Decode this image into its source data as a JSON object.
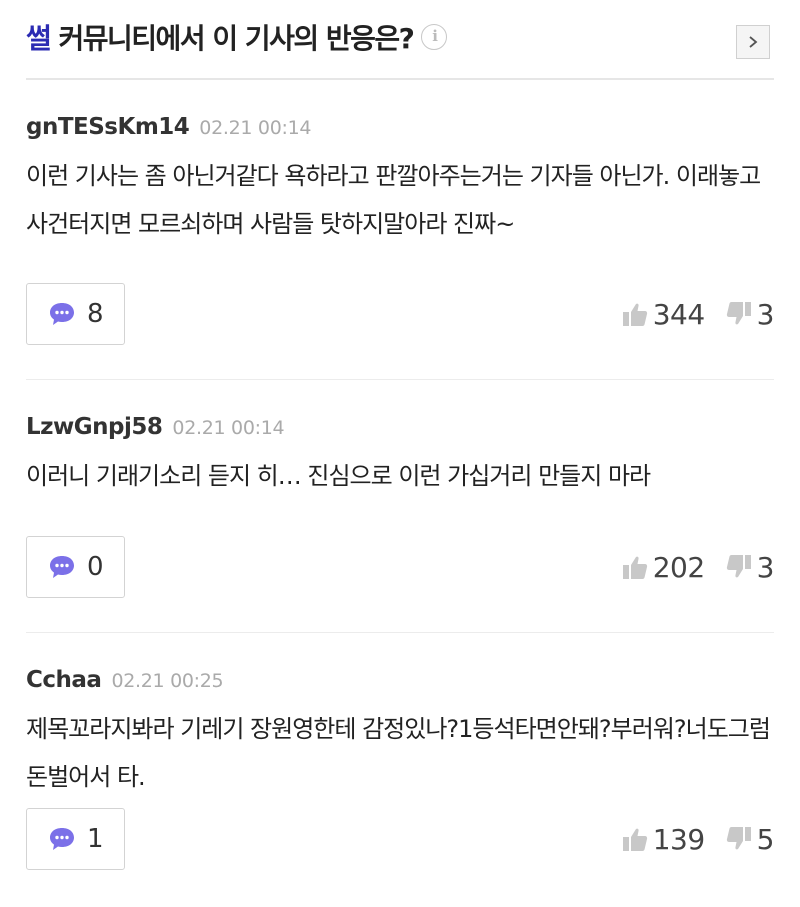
{
  "header": {
    "brand": "썰",
    "title_rest": " 커뮤니티에서 이 기사의 반응은?",
    "info_glyph": "i",
    "more_icon": "chevron-right-icon"
  },
  "colors": {
    "brand": "#2b2bb3",
    "reply_bubble": "#7b70e8",
    "thumb": "#c8c8c8"
  },
  "comments": [
    {
      "author": "gnTESsKm14",
      "date": "02.21 00:14",
      "text": "이런 기사는 좀 아닌거같다 욕하라고 판깔아주는거는 기자들 아닌가. 이래놓고 사건터지면 모르쇠하며 사람들 탓하지말아라 진짜~",
      "replies": "8",
      "likes": "344",
      "dislikes": "3"
    },
    {
      "author": "LzwGnpj58",
      "date": "02.21 00:14",
      "text": "이러니 기래기소리 듣지 히… 진심으로 이런 가십거리 만들지 마라",
      "replies": "0",
      "likes": "202",
      "dislikes": "3"
    },
    {
      "author": "Cchaa",
      "date": "02.21 00:25",
      "text": "제목꼬라지봐라 기레기 장원영한테 감정있나?1등석타면안돼?부러워?너도그럼 돈벌어서 타.",
      "replies": "1",
      "likes": "139",
      "dislikes": "5"
    }
  ]
}
